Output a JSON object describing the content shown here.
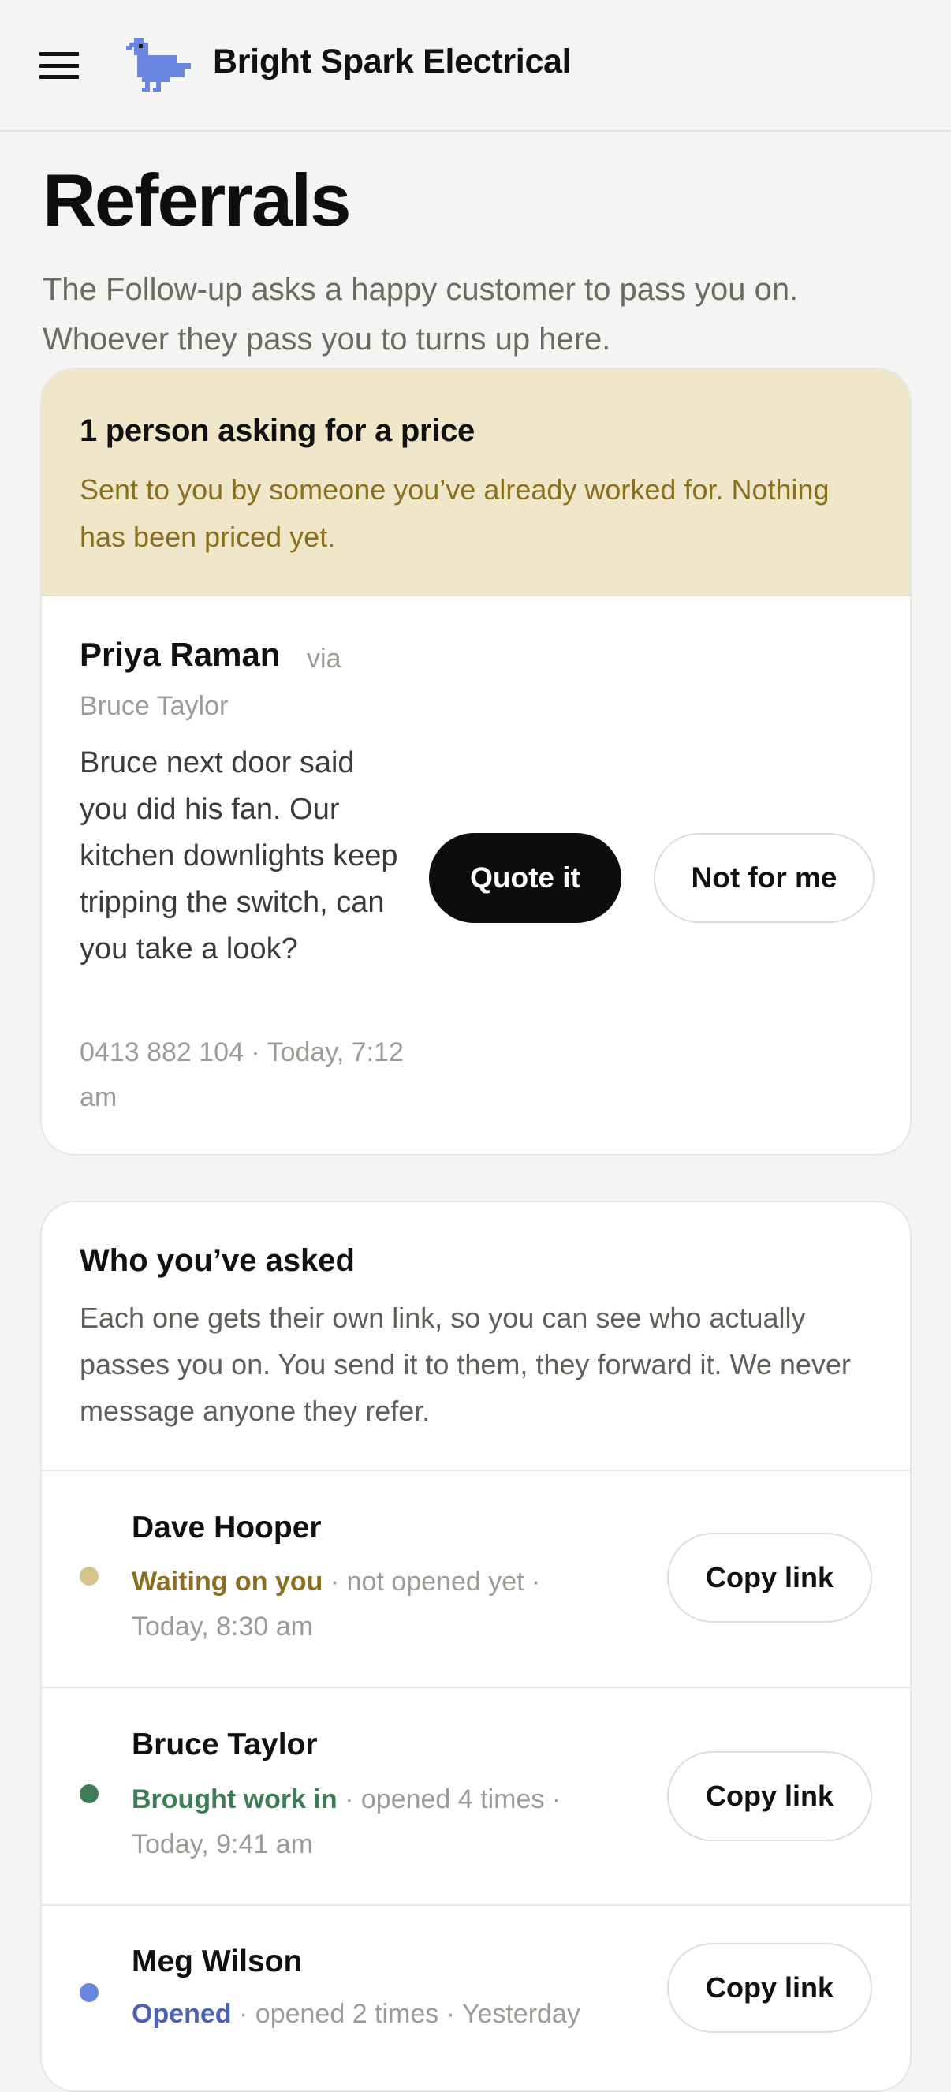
{
  "header": {
    "brand_name": "Bright Spark Electrical",
    "menu_icon": "hamburger-menu-icon",
    "logo_icon": "pixel-bird-logo"
  },
  "page": {
    "title": "Referrals",
    "subtitle": "The Follow-up asks a happy customer to pass you on. Whoever they pass you to turns up here."
  },
  "pending": {
    "heading": "1 person asking for a price",
    "description": "Sent to you by someone you’ve already worked for. Nothing has been priced yet.",
    "referral": {
      "name": "Priya Raman",
      "via_label": "via",
      "referrer": "Bruce Taylor",
      "message": "Bruce next door said you did his fan. Our kitchen downlights keep tripping the switch, can you take a look?",
      "meta": "0413 882 104 · Today, 7:12 am",
      "primary_action": "Quote it",
      "secondary_action": "Not for me"
    }
  },
  "asked": {
    "heading": "Who you’ve asked",
    "description": "Each one gets their own link, so you can see who actually passes you on. You send it to them, they forward it. We never message anyone they refer.",
    "people": [
      {
        "name": "Dave Hooper",
        "status": "Waiting on you",
        "detail": " · not opened yet · Today, 8:30 am",
        "status_color": "#8a6f1e",
        "dot_color": "#d5c28c",
        "action": "Copy link"
      },
      {
        "name": "Bruce Taylor",
        "status": "Brought work in",
        "detail": " · opened 4 times · Today, 9:41 am",
        "status_color": "#3d7d54",
        "dot_color": "#3d7d54",
        "action": "Copy link"
      },
      {
        "name": "Meg Wilson",
        "status": "Opened",
        "detail": " · opened 2 times · Yesterday",
        "status_color": "#4b62b5",
        "dot_color": "#6a86e0",
        "action": "Copy link"
      }
    ]
  },
  "colors": {
    "background": "#f4f4f2",
    "banner": "#f0e6c9",
    "banner_text": "#8a6f1e",
    "logo_blue": "#6a86e0",
    "primary_button": "#0d0d0d"
  }
}
